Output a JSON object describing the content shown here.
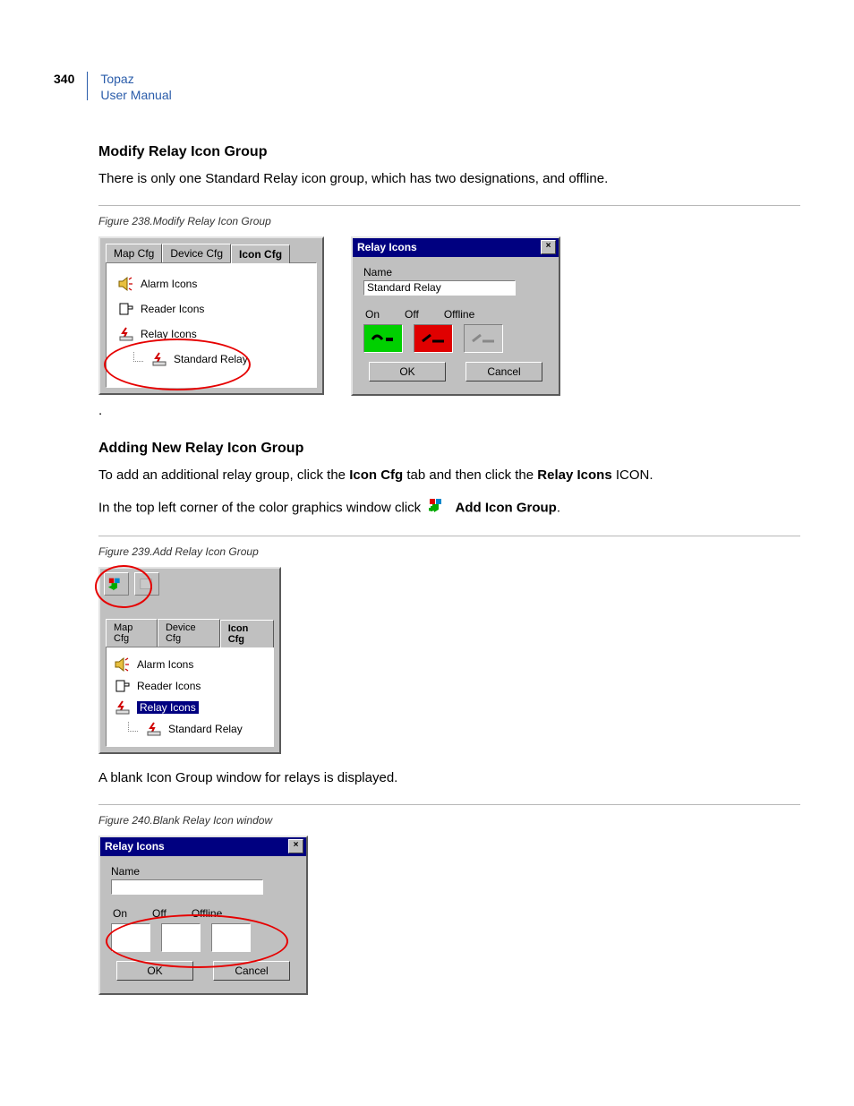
{
  "header": {
    "page_number": "340",
    "product": "Topaz",
    "doc": "User Manual"
  },
  "section1": {
    "heading": "Modify Relay Icon Group",
    "para": "There is only one Standard Relay icon group, which has two designations, and offline."
  },
  "figure238": {
    "caption": "Figure 238.Modify Relay Icon Group",
    "left_panel": {
      "tabs": {
        "map": "Map Cfg",
        "device": "Device Cfg",
        "icon": "Icon Cfg"
      },
      "items": {
        "alarm": "Alarm Icons",
        "reader": "Reader Icons",
        "relay": "Relay Icons",
        "standard": "Standard Relay"
      }
    },
    "dialog": {
      "title": "Relay Icons",
      "name_label": "Name",
      "name_value": "Standard Relay",
      "col_on": "On",
      "col_off": "Off",
      "col_offline": "Offline",
      "ok": "OK",
      "cancel": "Cancel"
    }
  },
  "section2": {
    "heading": "Adding New Relay Icon Group",
    "para1_pre": "To add an additional relay group, click the ",
    "para1_b1": "Icon Cfg",
    "para1_mid": " tab and then click the ",
    "para1_b2": "Relay Icons",
    "para1_post": " ICON.",
    "para2_pre": "In the top left corner of the color graphics window click ",
    "para2_b": "Add Icon Group",
    "para2_post": "."
  },
  "figure239": {
    "caption": "Figure 239.Add Relay Icon Group",
    "tabs": {
      "map": "Map Cfg",
      "device": "Device Cfg",
      "icon": "Icon Cfg"
    },
    "items": {
      "alarm": "Alarm Icons",
      "reader": "Reader Icons",
      "relay": "Relay Icons",
      "standard": "Standard Relay"
    }
  },
  "section3": {
    "para": "A blank Icon Group window for relays is displayed."
  },
  "figure240": {
    "caption": "Figure 240.Blank Relay Icon window",
    "dialog": {
      "title": "Relay Icons",
      "name_label": "Name",
      "name_value": "",
      "col_on": "On",
      "col_off": "Off",
      "col_offline": "Offline",
      "ok": "OK",
      "cancel": "Cancel"
    }
  },
  "period": "."
}
